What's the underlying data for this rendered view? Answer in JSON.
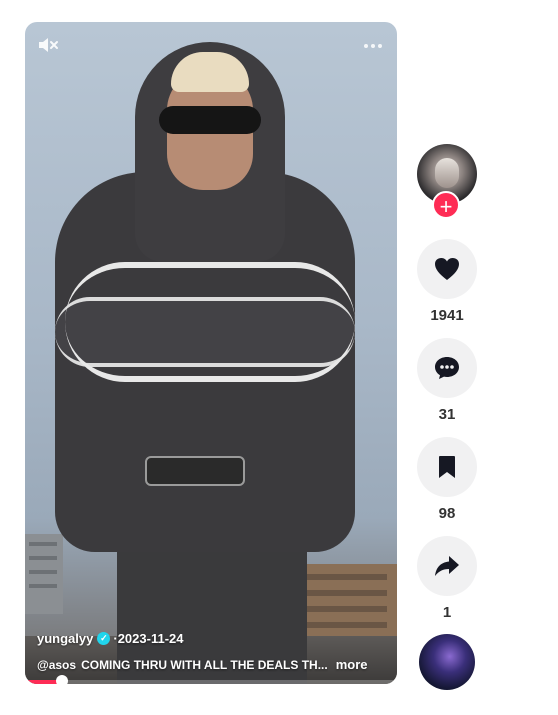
{
  "video": {
    "author": "yungalyy",
    "separator": " · ",
    "date": "2023-11-24",
    "mention": "@asos",
    "caption": "COMING THRU WITH ALL THE DEALS TH...",
    "more_label": "more",
    "progress": 0.1
  },
  "actions": {
    "likes": "1941",
    "comments": "31",
    "saves": "98",
    "shares": "1"
  },
  "icons": {
    "mute": "volume-muted-icon",
    "more": "more-options-icon",
    "like": "heart-icon",
    "comment": "comment-bubble-icon",
    "save": "bookmark-icon",
    "share": "share-arrow-icon",
    "follow": "plus-icon",
    "verified": "verified-check-icon"
  },
  "colors": {
    "accent": "#fe2c55",
    "verified": "#20d5ec",
    "action_bg": "#f1f1f2"
  }
}
